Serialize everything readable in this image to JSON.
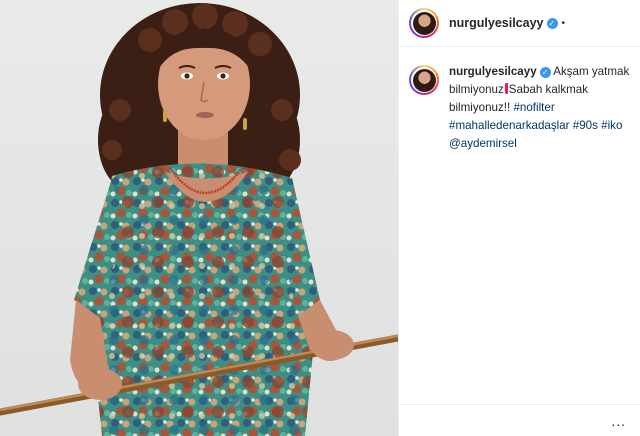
{
  "post": {
    "image_description_icon": "photo",
    "author": {
      "username": "nurgulyesilcayy",
      "verified_icon": "verified-badge-icon",
      "separator": "•"
    },
    "caption": {
      "username": "nurgulyesilcayy",
      "text_part1": "Akşam yatmak bilmiyonuz",
      "text_part2": "Sabah kalkmak bilmiyonuz!!",
      "hashtags": [
        "#nofilter",
        "#mahalledenarkadaşlar",
        "#90s",
        "#iko"
      ],
      "mention": "@aydemirsel"
    },
    "more_options": "..."
  },
  "colors": {
    "link": "#00376b",
    "verified": "#3897f0",
    "text": "#262626",
    "border": "#efefef"
  }
}
